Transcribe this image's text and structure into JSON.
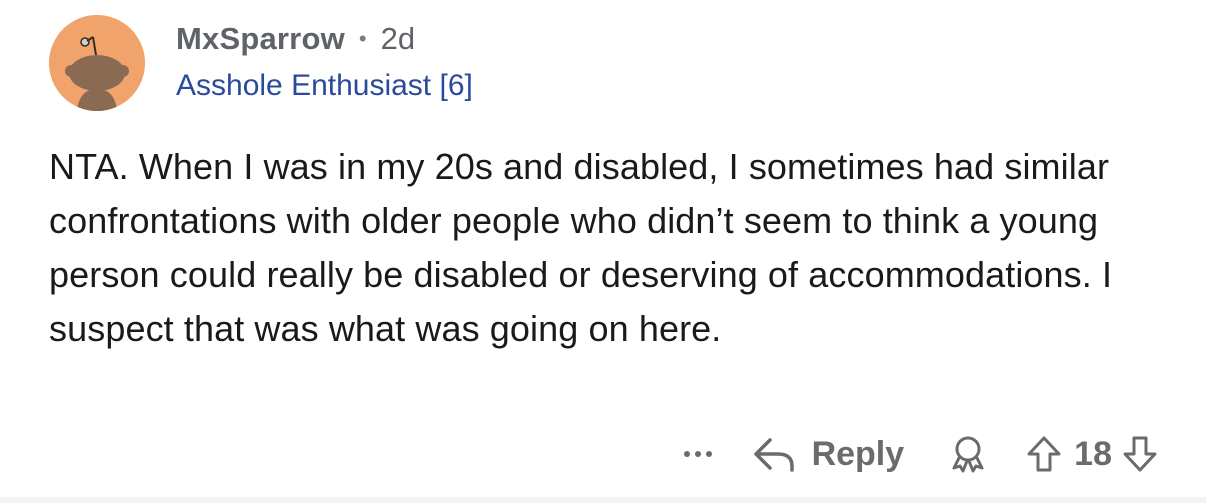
{
  "comment": {
    "author": "MxSparrow",
    "separator": "•",
    "age": "2d",
    "flair": "Asshole Enthusiast [6]",
    "body": "NTA. When I was in my 20s and disabled, I sometimes had similar confrontations with older people who didn’t seem to think a young person could really be disabled or deserving of accommodations. I suspect that was what was going on here.",
    "score": "18"
  },
  "actions": {
    "reply_label": "Reply",
    "more_icon": "ellipsis-icon",
    "reply_icon": "reply-arrow-icon",
    "award_icon": "award-icon",
    "upvote_icon": "upvote-arrow-icon",
    "downvote_icon": "downvote-arrow-icon"
  },
  "colors": {
    "avatar_bg": "#f0a46c",
    "flair_text": "#2b4a9c",
    "meta_text": "#5f6368",
    "action_text": "#6b6b6b"
  }
}
